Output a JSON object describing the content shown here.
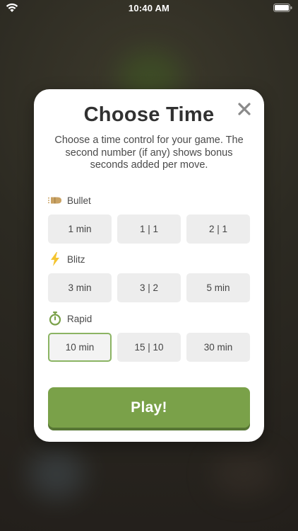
{
  "status_bar": {
    "time": "10:40 AM"
  },
  "dialog": {
    "title": "Choose Time",
    "subtitle": "Choose a time control for your game. The second number (if any) shows bonus seconds added per move.",
    "sections": [
      {
        "label": "Bullet",
        "icon": "bullet-icon",
        "options": [
          "1 min",
          "1 | 1",
          "2 | 1"
        ]
      },
      {
        "label": "Blitz",
        "icon": "lightning-icon",
        "options": [
          "3 min",
          "3 | 2",
          "5 min"
        ]
      },
      {
        "label": "Rapid",
        "icon": "stopwatch-icon",
        "options": [
          "10 min",
          "15 | 10",
          "30 min"
        ]
      }
    ],
    "selected_option": "10 min",
    "play_label": "Play!"
  },
  "colors": {
    "accent_green": "#7aa149",
    "selected_border": "#8bb463",
    "blitz_yellow": "#f4c430",
    "bullet_tan": "#c9a264"
  }
}
